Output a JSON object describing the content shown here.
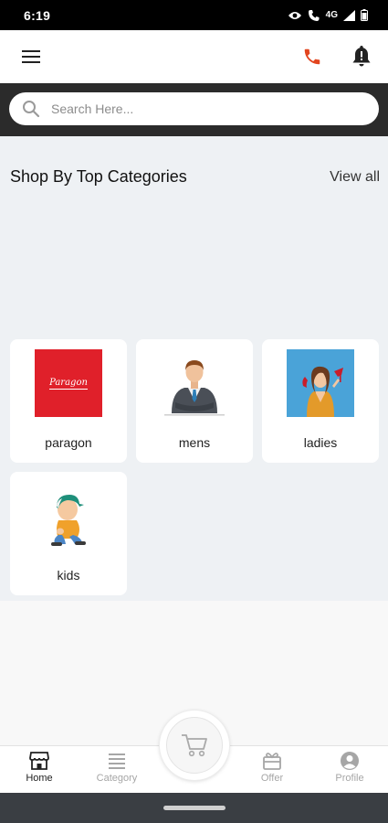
{
  "status_bar": {
    "time": "6:19",
    "network": "4G"
  },
  "search": {
    "placeholder": "Search Here..."
  },
  "section": {
    "title": "Shop By Top Categories",
    "view_all": "View all"
  },
  "categories": [
    {
      "label": "paragon",
      "brand_text": "Paragon",
      "icon": "paragon-logo"
    },
    {
      "label": "mens",
      "icon": "man-in-suit"
    },
    {
      "label": "ladies",
      "icon": "woman-with-shoe"
    },
    {
      "label": "kids",
      "icon": "child-in-cap"
    }
  ],
  "bottom_nav": [
    {
      "label": "Home",
      "icon": "store-icon",
      "active": true
    },
    {
      "label": "Category",
      "icon": "list-icon",
      "active": false
    },
    {
      "label": "Offer",
      "icon": "gift-icon",
      "active": false
    },
    {
      "label": "Profile",
      "icon": "person-icon",
      "active": false
    }
  ],
  "colors": {
    "accent": "#e2451f",
    "search_band": "#2b2b2b",
    "content_bg": "#eef1f4",
    "brand_red": "#e0202a"
  }
}
